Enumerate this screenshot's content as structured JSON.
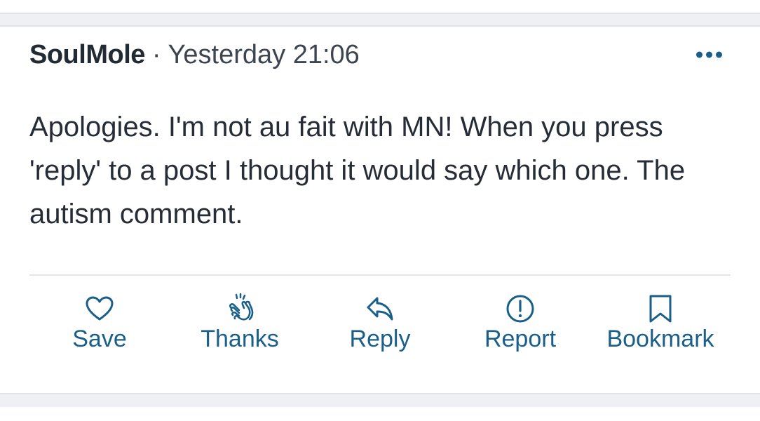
{
  "post": {
    "author": "SoulMole",
    "separator": "·",
    "timestamp": "Yesterday 21:06",
    "body": "Apologies. I'm not au fait with MN! When you press 'reply' to a post I thought it would say which one. The autism comment."
  },
  "actions": [
    {
      "label": "Save",
      "icon": "heart-icon"
    },
    {
      "label": "Thanks",
      "icon": "clapping-hands-icon"
    },
    {
      "label": "Reply",
      "icon": "reply-arrow-icon"
    },
    {
      "label": "Report",
      "icon": "exclamation-circle-icon"
    },
    {
      "label": "Bookmark",
      "icon": "bookmark-icon"
    }
  ],
  "colors": {
    "accent": "#1a5f8a",
    "text": "#262d36",
    "background": "#ffffff",
    "page_background": "#eef0f3"
  }
}
